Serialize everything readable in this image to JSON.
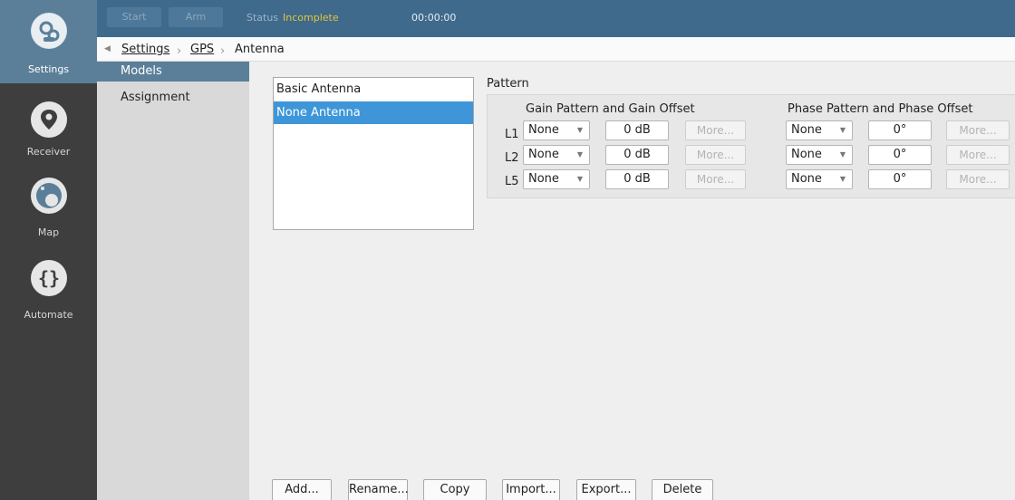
{
  "nav": {
    "items": [
      {
        "label": "Settings",
        "icon": "gear-icon"
      },
      {
        "label": "Receiver",
        "icon": "location-pin-icon"
      },
      {
        "label": "Map",
        "icon": "globe-icon"
      },
      {
        "label": "Automate",
        "icon": "braces-icon"
      }
    ]
  },
  "topbar": {
    "start_label": "Start",
    "arm_label": "Arm",
    "status_label": "Status",
    "status_value": "Incomplete",
    "status_color": "#e3c43a",
    "timer": "00:00:00"
  },
  "breadcrumb": {
    "items": [
      "Settings",
      "GPS",
      "Antenna"
    ]
  },
  "submenu": {
    "items": [
      "Models",
      "Assignment"
    ]
  },
  "antennas": {
    "items": [
      "Basic Antenna",
      "None Antenna"
    ],
    "selected": "None Antenna"
  },
  "pattern": {
    "title": "Pattern",
    "gain_header": "Gain Pattern and Gain Offset",
    "phase_header": "Phase Pattern and Phase Offset",
    "rows": [
      {
        "label": "L1",
        "gain_pattern": "None",
        "gain_offset": "0 dB",
        "gain_more": "More...",
        "phase_pattern": "None",
        "phase_offset": "0°",
        "phase_more": "More..."
      },
      {
        "label": "L2",
        "gain_pattern": "None",
        "gain_offset": "0 dB",
        "gain_more": "More...",
        "phase_pattern": "None",
        "phase_offset": "0°",
        "phase_more": "More..."
      },
      {
        "label": "L5",
        "gain_pattern": "None",
        "gain_offset": "0 dB",
        "gain_more": "More...",
        "phase_pattern": "None",
        "phase_offset": "0°",
        "phase_more": "More..."
      }
    ]
  },
  "actions": {
    "add": "Add...",
    "rename": "Rename...",
    "copy": "Copy",
    "import": "Import...",
    "export": "Export...",
    "delete": "Delete"
  }
}
